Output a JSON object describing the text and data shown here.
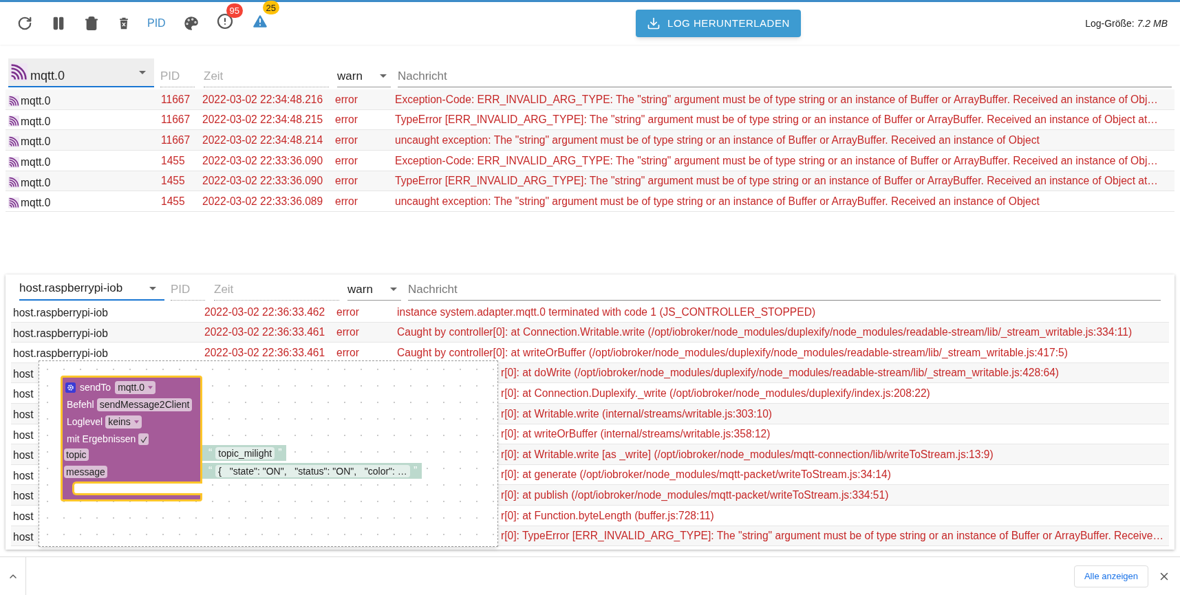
{
  "toolbar": {
    "pid_toggle": {
      "label": "PID",
      "selected": true
    },
    "error_badge": "95",
    "warning_badge": "25",
    "download_button": "LOG HERUNTERLADEN",
    "log_size": "Log-Größe: *7.2 MB*"
  },
  "top_log": {
    "filters": {
      "source": "mqtt.0",
      "pid_placeholder": "PID",
      "time_placeholder": "Zeit",
      "level": "warn",
      "message_placeholder": "Nachricht"
    },
    "rows": [
      {
        "source": "mqtt.0",
        "pid": "11667",
        "time": "2022-03-02 22:34:48.216",
        "level": "error",
        "message": "Exception-Code: ERR_INVALID_ARG_TYPE: The \"string\" argument must be of type string or an instance of Buffer or ArrayBuffer. Received an instance of Obj…"
      },
      {
        "source": "mqtt.0",
        "pid": "11667",
        "time": "2022-03-02 22:34:48.215",
        "level": "error",
        "message": "TypeError [ERR_INVALID_ARG_TYPE]: The \"string\" argument must be of type string or an instance of Buffer or ArrayBuffer. Received an instance of Object at…"
      },
      {
        "source": "mqtt.0",
        "pid": "11667",
        "time": "2022-03-02 22:34:48.214",
        "level": "error",
        "message": "uncaught exception: The \"string\" argument must be of type string or an instance of Buffer or ArrayBuffer. Received an instance of Object"
      },
      {
        "source": "mqtt.0",
        "pid": "1455",
        "time": "2022-03-02 22:33:36.090",
        "level": "error",
        "message": "Exception-Code: ERR_INVALID_ARG_TYPE: The \"string\" argument must be of type string or an instance of Buffer or ArrayBuffer. Received an instance of Obj…"
      },
      {
        "source": "mqtt.0",
        "pid": "1455",
        "time": "2022-03-02 22:33:36.090",
        "level": "error",
        "message": "TypeError [ERR_INVALID_ARG_TYPE]: The \"string\" argument must be of type string or an instance of Buffer or ArrayBuffer. Received an instance of Object at…"
      },
      {
        "source": "mqtt.0",
        "pid": "1455",
        "time": "2022-03-02 22:33:36.089",
        "level": "error",
        "message": "uncaught exception: The \"string\" argument must be of type string or an instance of Buffer or ArrayBuffer. Received an instance of Object"
      }
    ]
  },
  "bottom_log": {
    "filters": {
      "source": "host.raspberrypi-iob",
      "pid_placeholder": "PID",
      "time_placeholder": "Zeit",
      "level": "warn",
      "message_placeholder": "Nachricht"
    },
    "rows": [
      {
        "covered": false,
        "source": "host.raspberrypi-iob",
        "time": "2022-03-02 22:36:33.462",
        "level": "error",
        "message": "instance system.adapter.mqtt.0 terminated with code 1 (JS_CONTROLLER_STOPPED)"
      },
      {
        "covered": false,
        "source": "host.raspberrypi-iob",
        "time": "2022-03-02 22:36:33.461",
        "level": "error",
        "message": "Caught by controller[0]: at Connection.Writable.write (/opt/iobroker/node_modules/duplexify/node_modules/readable-stream/lib/_stream_writable.js:334:11)"
      },
      {
        "covered": false,
        "source": "host.raspberrypi-iob",
        "time": "2022-03-02 22:36:33.461",
        "level": "error",
        "message": "Caught by controller[0]: at writeOrBuffer (/opt/iobroker/node_modules/duplexify/node_modules/readable-stream/lib/_stream_writable.js:417:5)"
      },
      {
        "covered": true,
        "source": "host",
        "message": "r[0]: at doWrite (/opt/iobroker/node_modules/duplexify/node_modules/readable-stream/lib/_stream_writable.js:428:64)"
      },
      {
        "covered": true,
        "source": "host",
        "message": "r[0]: at Connection.Duplexify._write (/opt/iobroker/node_modules/duplexify/index.js:208:22)"
      },
      {
        "covered": true,
        "source": "host",
        "message": "r[0]: at Writable.write (internal/streams/writable.js:303:10)"
      },
      {
        "covered": true,
        "source": "host",
        "message": "r[0]: at writeOrBuffer (internal/streams/writable.js:358:12)"
      },
      {
        "covered": true,
        "source": "host",
        "message": "r[0]: at Writable.write [as _write] (/opt/iobroker/node_modules/mqtt-connection/lib/writeToStream.js:13:9)"
      },
      {
        "covered": true,
        "source": "host",
        "message": "r[0]: at generate (/opt/iobroker/node_modules/mqtt-packet/writeToStream.js:34:14)"
      },
      {
        "covered": true,
        "source": "host",
        "message": "r[0]: at publish (/opt/iobroker/node_modules/mqtt-packet/writeToStream.js:334:51)"
      },
      {
        "covered": true,
        "source": "host",
        "message": "r[0]: at Function.byteLength (buffer.js:728:11)"
      },
      {
        "covered": true,
        "source": "host",
        "message": "r[0]: TypeError [ERR_INVALID_ARG_TYPE]: The \"string\" argument must be of type string or an instance of Buffer or ArrayBuffer. Receive…"
      }
    ]
  },
  "blockly": {
    "title": "sendTo",
    "instance": "mqtt.0",
    "command_label": "Befehl",
    "command": "sendMessage2Client",
    "loglevel_label": "Loglevel",
    "loglevel": "keins",
    "results_label": "mit Ergebnissen",
    "results_checked": true,
    "inputs": [
      {
        "label": "topic",
        "open_quote": "“",
        "value": "topic_milight",
        "close_quote": "”"
      },
      {
        "label": "message",
        "open_quote": "“",
        "value": "{   \"state\": \"ON\",   \"status\": \"ON\",   \"color\": …",
        "close_quote": "”"
      }
    ]
  },
  "download_bar": {
    "button": "Alle anzeigen"
  }
}
